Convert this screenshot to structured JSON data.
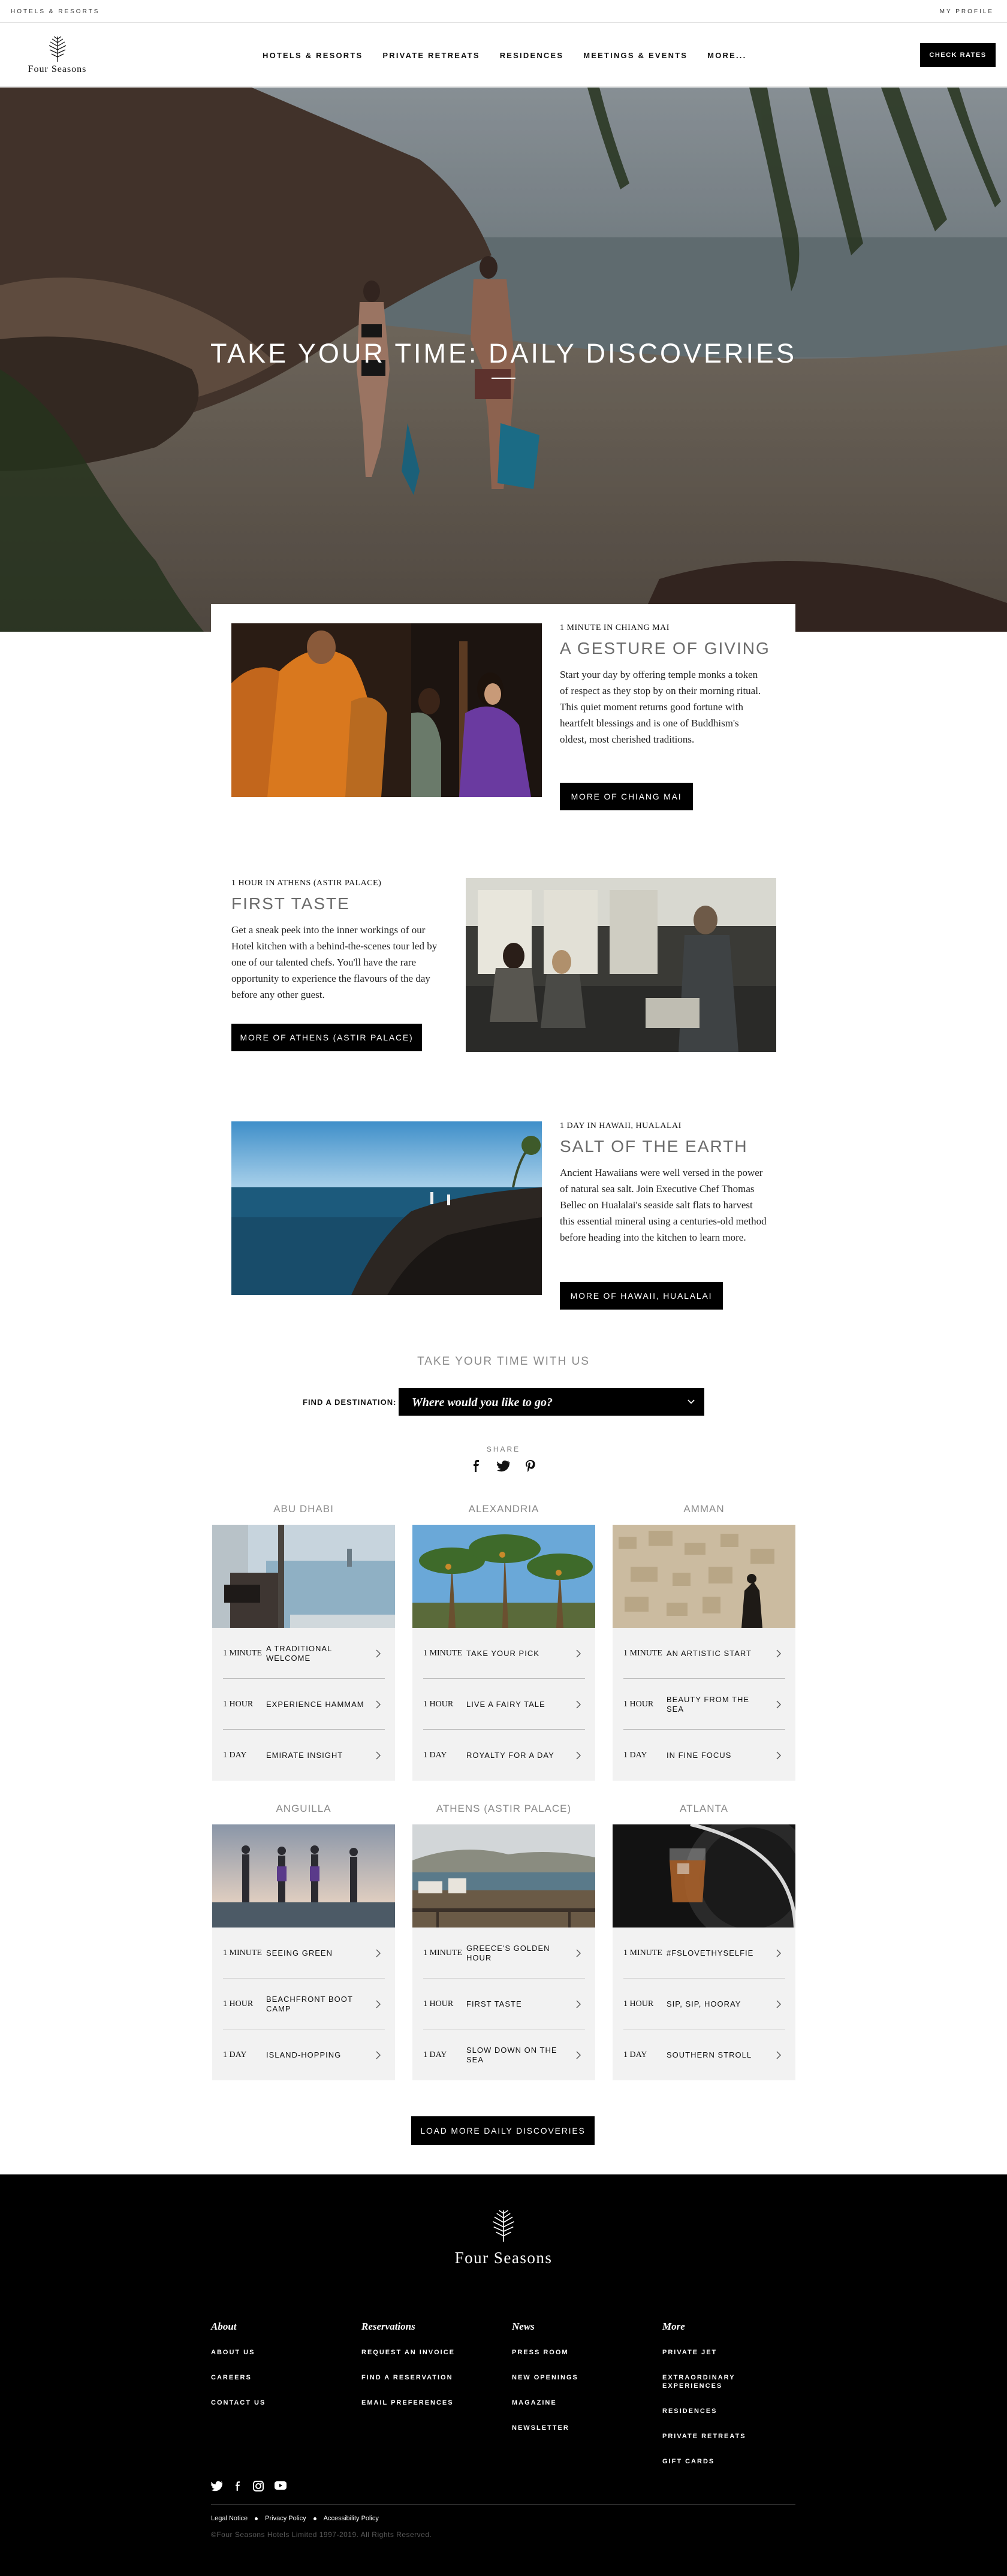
{
  "utility": {
    "left_label": "HOTELS & RESORTS",
    "right_label": "MY PROFILE"
  },
  "header": {
    "logo_text": "Four Seasons",
    "nav": [
      "HOTELS & RESORTS",
      "PRIVATE RETREATS",
      "RESIDENCES",
      "MEETINGS & EVENTS",
      "MORE..."
    ],
    "cta": "CHECK RATES"
  },
  "hero": {
    "title": "TAKE YOUR TIME: DAILY DISCOVERIES"
  },
  "stories": [
    {
      "eyebrow": "1 MINUTE IN CHIANG MAI",
      "title": "A GESTURE OF GIVING",
      "body": "Start your day by offering temple monks a token of respect as they stop by on their morning ritual. This quiet moment returns good fortune with heartfelt blessings and is one of Buddhism's oldest, most cherished traditions.",
      "button": "MORE OF CHIANG MAI"
    },
    {
      "eyebrow": "1 HOUR IN ATHENS (ASTIR PALACE)",
      "title": "FIRST TASTE",
      "body": "Get a sneak peek into the inner workings of our Hotel kitchen with a behind-the-scenes tour led by one of our talented chefs. You'll have the rare opportunity to experience the flavours of the day before any other guest.",
      "button": "MORE OF ATHENS (ASTIR PALACE)"
    },
    {
      "eyebrow": "1 DAY IN HAWAII, HUALALAI",
      "title": "SALT OF THE EARTH",
      "body": "Ancient Hawaiians were well versed in the power of natural sea salt. Join Executive Chef Thomas Bellec on Hualalai's seaside salt flats to harvest this essential mineral using a centuries-old method before heading into the kitchen to learn more.",
      "button": "MORE OF HAWAII, HUALALAI"
    }
  ],
  "take_your_time": {
    "title": "TAKE YOUR TIME WITH US",
    "find_label": "FIND A DESTINATION:",
    "find_placeholder": "Where would you like to go?",
    "share_label": "SHARE"
  },
  "destinations": [
    {
      "name": "ABU DHABI",
      "items": [
        [
          "1 MINUTE",
          "A TRADITIONAL WELCOME"
        ],
        [
          "1 HOUR",
          "EXPERIENCE HAMMAM"
        ],
        [
          "1 DAY",
          "EMIRATE INSIGHT"
        ]
      ]
    },
    {
      "name": "ALEXANDRIA",
      "items": [
        [
          "1 MINUTE",
          "TAKE YOUR PICK"
        ],
        [
          "1 HOUR",
          "LIVE A FAIRY TALE"
        ],
        [
          "1 DAY",
          "ROYALTY FOR A DAY"
        ]
      ]
    },
    {
      "name": "AMMAN",
      "items": [
        [
          "1 MINUTE",
          "AN ARTISTIC START"
        ],
        [
          "1 HOUR",
          "BEAUTY FROM THE SEA"
        ],
        [
          "1 DAY",
          "IN FINE FOCUS"
        ]
      ]
    },
    {
      "name": "ANGUILLA",
      "items": [
        [
          "1 MINUTE",
          "SEEING GREEN"
        ],
        [
          "1 HOUR",
          "BEACHFRONT BOOT CAMP"
        ],
        [
          "1 DAY",
          "ISLAND-HOPPING"
        ]
      ]
    },
    {
      "name": "ATHENS (ASTIR PALACE)",
      "items": [
        [
          "1 MINUTE",
          "GREECE'S GOLDEN HOUR"
        ],
        [
          "1 HOUR",
          "FIRST TASTE"
        ],
        [
          "1 DAY",
          "SLOW DOWN ON THE SEA"
        ]
      ]
    },
    {
      "name": "ATLANTA",
      "items": [
        [
          "1 MINUTE",
          "#FSLOVETHYSELFIE"
        ],
        [
          "1 HOUR",
          "SIP, SIP, HOORAY"
        ],
        [
          "1 DAY",
          "SOUTHERN STROLL"
        ]
      ]
    }
  ],
  "load_more": "LOAD MORE DAILY DISCOVERIES",
  "footer": {
    "logo_text": "Four Seasons",
    "columns": [
      {
        "heading": "About",
        "links": [
          "ABOUT US",
          "CAREERS",
          "CONTACT US"
        ]
      },
      {
        "heading": "Reservations",
        "links": [
          "REQUEST AN INVOICE",
          "FIND A RESERVATION",
          "EMAIL PREFERENCES"
        ]
      },
      {
        "heading": "News",
        "links": [
          "PRESS ROOM",
          "NEW OPENINGS",
          "MAGAZINE",
          "NEWSLETTER"
        ]
      },
      {
        "heading": "More",
        "links": [
          "PRIVATE JET",
          "EXTRAORDINARY EXPERIENCES",
          "RESIDENCES",
          "PRIVATE RETREATS",
          "GIFT CARDS"
        ]
      }
    ],
    "social": [
      "twitter-icon",
      "facebook-icon",
      "instagram-icon",
      "youtube-icon"
    ],
    "legal": [
      "Legal Notice",
      "Privacy Policy",
      "Accessibility Policy"
    ],
    "copyright": "©Four Seasons Hotels Limited 1997-2019. All Rights Reserved."
  }
}
